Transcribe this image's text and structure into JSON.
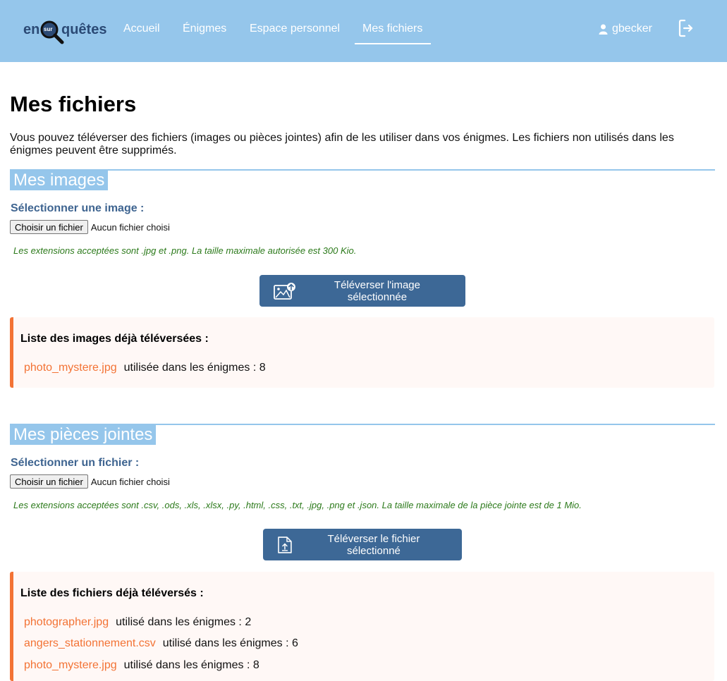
{
  "header": {
    "logo": {
      "left": "en",
      "middle": "sur",
      "right": "quêtes"
    },
    "nav": [
      {
        "label": "Accueil"
      },
      {
        "label": "Énigmes"
      },
      {
        "label": "Espace personnel"
      },
      {
        "label": "Mes fichiers"
      }
    ],
    "active_nav": "Mes fichiers",
    "username": "gbecker",
    "icons": {
      "user": "user-icon",
      "logout": "logout-icon"
    }
  },
  "page": {
    "title": "Mes fichiers",
    "intro": "Vous pouvez téléverser des fichiers (images ou pièces jointes) afin de les utiliser dans vos énigmes. Les fichiers non utilisés dans les énigmes peuvent être supprimés."
  },
  "images": {
    "section_title": "Mes images",
    "select_label": "Sélectionner une image :",
    "file_button": "Choisir un fichier",
    "file_status": "Aucun fichier choisi",
    "hint": "Les extensions acceptées sont .jpg et .png. La taille maximale autorisée est 300 Kio.",
    "upload_button": "Téléverser l'image sélectionnée",
    "list_title": "Liste des images déjà téléversées :",
    "items": [
      {
        "name": "photo_mystere.jpg",
        "usage": "utilisée dans les énigmes : 8"
      }
    ]
  },
  "attachments": {
    "section_title": "Mes pièces jointes",
    "select_label": "Sélectionner un fichier :",
    "file_button": "Choisir un fichier",
    "file_status": "Aucun fichier choisi",
    "hint": "Les extensions acceptées sont .csv, .ods, .xls, .xlsx, .py, .html, .css, .txt, .jpg, .png et .json. La taille maximale de la pièce jointe est de 1 Mio.",
    "upload_button": "Téléverser le fichier sélectionné",
    "list_title": "Liste des fichiers déjà téléversés :",
    "items": [
      {
        "name": "photographer.jpg",
        "usage": "utilisé dans les énigmes : 2"
      },
      {
        "name": "angers_stationnement.csv",
        "usage": "utilisé dans les énigmes : 6"
      },
      {
        "name": "photo_mystere.jpg",
        "usage": "utilisé dans les énigmes : 8"
      }
    ]
  },
  "colors": {
    "header_bg": "#95c6eb",
    "primary_button": "#3d6896",
    "accent_orange": "#f37335",
    "hint_green": "#2c7a1b",
    "label_blue": "#3e6490"
  }
}
